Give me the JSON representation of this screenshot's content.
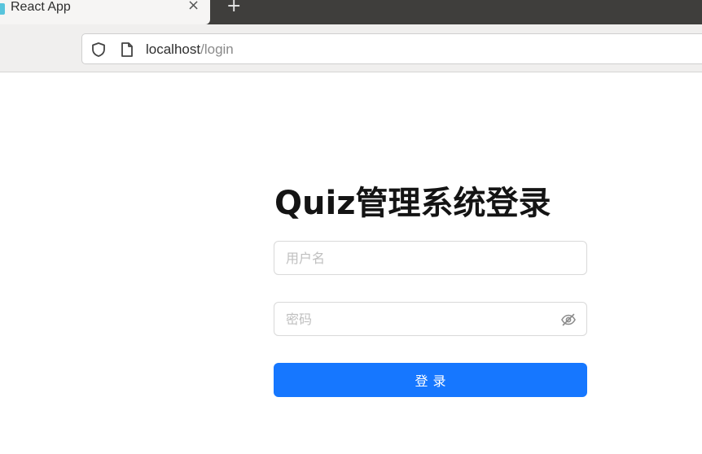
{
  "browser": {
    "tab": {
      "title": "React App",
      "close_glyph": "×",
      "favicon": "react-icon"
    },
    "new_tab_glyph": "+",
    "address": {
      "host": "localhost",
      "path": "/login",
      "security_icon": "shield-icon",
      "page_icon": "page-icon"
    }
  },
  "login": {
    "title": "Quiz管理系统登录",
    "username": {
      "placeholder": "用户名",
      "value": ""
    },
    "password": {
      "placeholder": "密码",
      "value": "",
      "toggle_icon": "eye-slash-icon"
    },
    "submit_label": "登录"
  },
  "colors": {
    "primary": "#1677ff",
    "tabbar": "#3f3e3c",
    "input_border": "#d9d9d9",
    "placeholder": "#bfbfbf"
  }
}
